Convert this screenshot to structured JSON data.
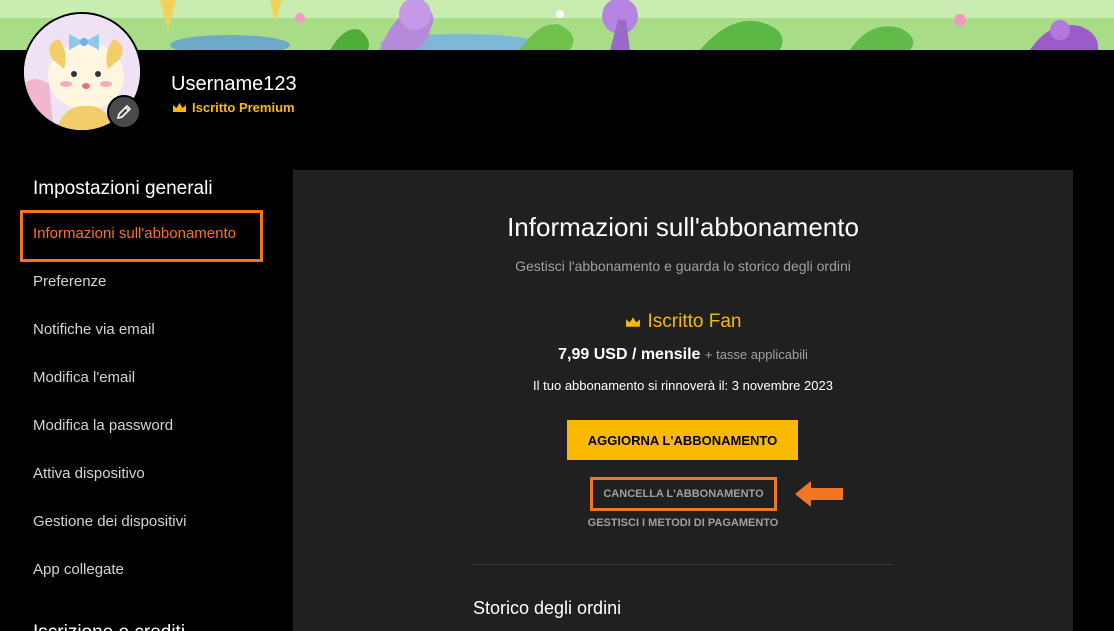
{
  "profile": {
    "username": "Username123",
    "membership": "Iscritto Premium"
  },
  "sidebar": {
    "heading": "Impostazioni generali",
    "items": [
      {
        "label": "Informazioni sull'abbonamento",
        "active": true
      },
      {
        "label": "Preferenze"
      },
      {
        "label": "Notifiche via email"
      },
      {
        "label": "Modifica l'email"
      },
      {
        "label": "Modifica la password"
      },
      {
        "label": "Attiva dispositivo"
      },
      {
        "label": "Gestione dei dispositivi"
      },
      {
        "label": "App collegate"
      }
    ],
    "heading_2": "Iscrizione e crediti"
  },
  "main": {
    "title": "Informazioni sull'abbonamento",
    "subtitle": "Gestisci l'abbonamento e guarda lo storico degli ordini",
    "tier": "Iscritto Fan",
    "price": "7,99 USD / mensile",
    "tax_note": "+ tasse applicabili",
    "renewal": "Il tuo abbonamento si rinnoverà il: 3 novembre 2023",
    "upgrade_label": "AGGIORNA L'ABBONAMENTO",
    "cancel_label": "CANCELLA L'ABBONAMENTO",
    "manage_payment_label": "GESTISCI I METODI DI PAGAMENTO",
    "orders_title": "Storico degli ordini"
  },
  "colors": {
    "accent_orange": "#f47521",
    "premium_gold": "#f8b900",
    "panel_bg": "#202020",
    "page_bg": "#000000"
  },
  "icons": {
    "crown": "crown-icon",
    "edit": "pencil-icon",
    "arrow": "arrow-left-icon"
  }
}
